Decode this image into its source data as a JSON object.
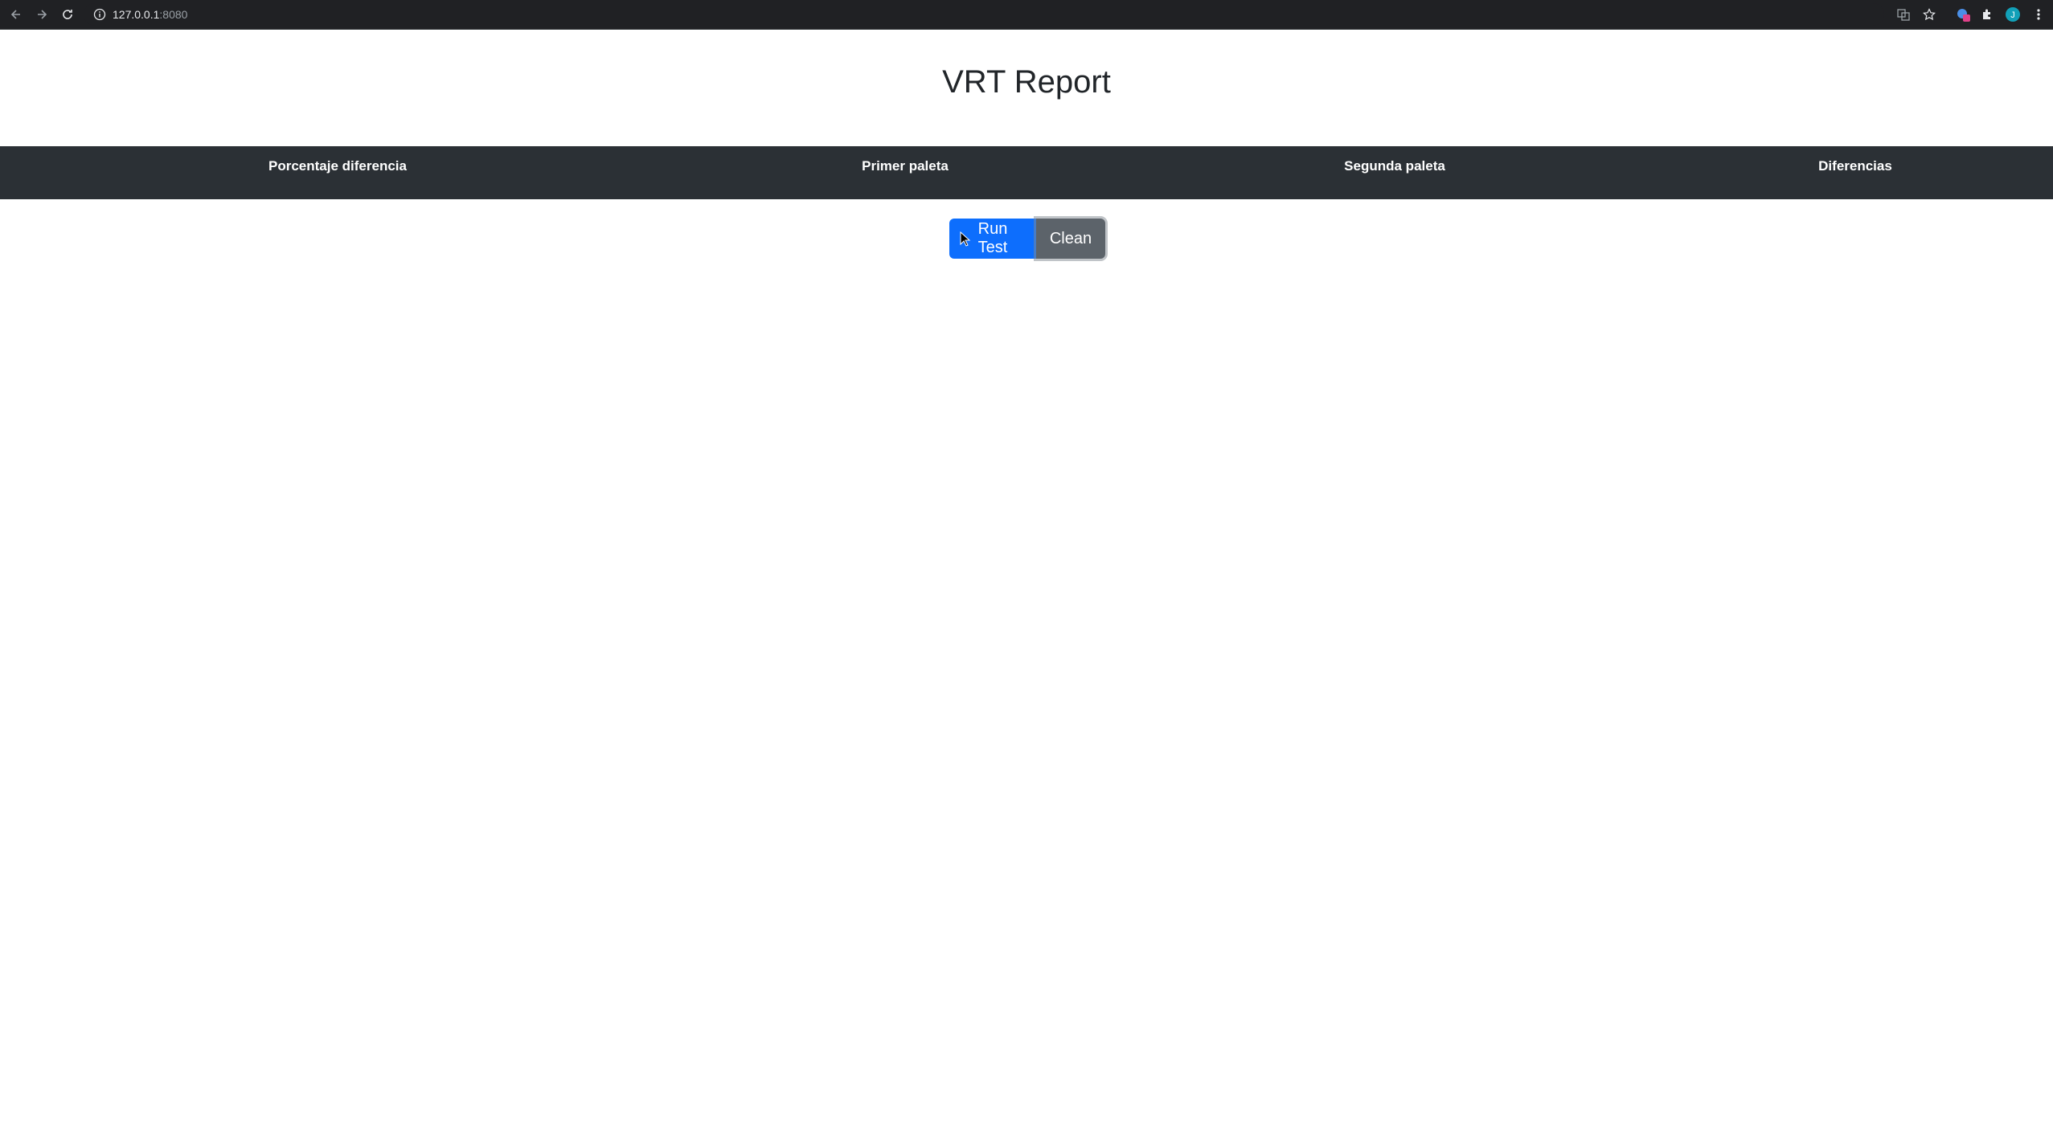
{
  "browser": {
    "url_host": "127.0.0.1",
    "url_port": ":8080"
  },
  "page": {
    "title": "VRT Report"
  },
  "table": {
    "headers": [
      "Porcentaje diferencia",
      "Primer paleta",
      "Segunda paleta",
      "Diferencias"
    ]
  },
  "actions": {
    "run_label": "Run Test",
    "clean_label": "Clean"
  },
  "colors": {
    "primary": "#0d6efd",
    "secondary": "#5c636a",
    "header_bg": "#2b3035"
  }
}
